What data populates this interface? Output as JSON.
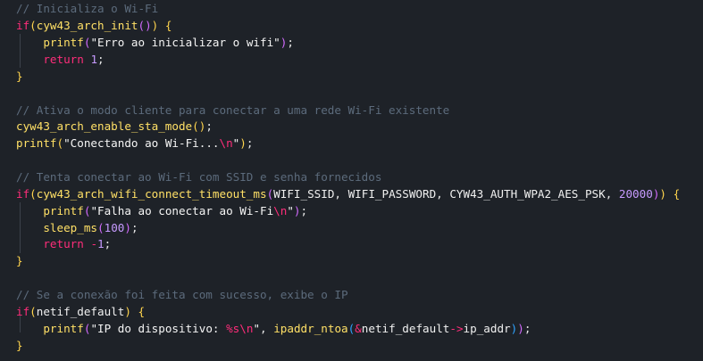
{
  "lines": [
    {
      "tokens": [
        {
          "t": "// Inicializa o Wi-Fi",
          "c": "cmt"
        }
      ]
    },
    {
      "tokens": [
        {
          "t": "if",
          "c": "kw"
        },
        {
          "t": "(",
          "c": "br1"
        },
        {
          "t": "cyw43_arch_init",
          "c": "fn"
        },
        {
          "t": "()",
          "c": "br2"
        },
        {
          "t": ")",
          "c": "br1"
        },
        {
          "t": " ",
          "c": "pun"
        },
        {
          "t": "{",
          "c": "br1"
        }
      ]
    },
    {
      "tokens": [
        {
          "t": "    ",
          "c": "pun"
        },
        {
          "t": "printf",
          "c": "fn"
        },
        {
          "t": "(",
          "c": "br2"
        },
        {
          "t": "\"Erro ao inicializar o wifi\"",
          "c": "str"
        },
        {
          "t": ")",
          "c": "br2"
        },
        {
          "t": ";",
          "c": "pun"
        }
      ]
    },
    {
      "tokens": [
        {
          "t": "    ",
          "c": "pun"
        },
        {
          "t": "return",
          "c": "kw"
        },
        {
          "t": " ",
          "c": "pun"
        },
        {
          "t": "1",
          "c": "num"
        },
        {
          "t": ";",
          "c": "pun"
        }
      ]
    },
    {
      "tokens": [
        {
          "t": "}",
          "c": "br1"
        }
      ]
    },
    {
      "tokens": []
    },
    {
      "tokens": [
        {
          "t": "// Ativa o modo cliente para conectar a uma rede Wi-Fi existente",
          "c": "cmt"
        }
      ]
    },
    {
      "tokens": [
        {
          "t": "cyw43_arch_enable_sta_mode",
          "c": "fn"
        },
        {
          "t": "()",
          "c": "br1"
        },
        {
          "t": ";",
          "c": "pun"
        }
      ]
    },
    {
      "tokens": [
        {
          "t": "printf",
          "c": "fn"
        },
        {
          "t": "(",
          "c": "br1"
        },
        {
          "t": "\"Conectando ao Wi-Fi...",
          "c": "str"
        },
        {
          "t": "\\n",
          "c": "esc"
        },
        {
          "t": "\"",
          "c": "str"
        },
        {
          "t": ")",
          "c": "br1"
        },
        {
          "t": ";",
          "c": "pun"
        }
      ]
    },
    {
      "tokens": []
    },
    {
      "tokens": [
        {
          "t": "// Tenta conectar ao Wi-Fi com SSID e senha fornecidos",
          "c": "cmt"
        }
      ]
    },
    {
      "tokens": [
        {
          "t": "if",
          "c": "kw"
        },
        {
          "t": "(",
          "c": "br1"
        },
        {
          "t": "cyw43_arch_wifi_connect_timeout_ms",
          "c": "fn"
        },
        {
          "t": "(",
          "c": "br2"
        },
        {
          "t": "WIFI_SSID",
          "c": "id"
        },
        {
          "t": ", ",
          "c": "pun"
        },
        {
          "t": "WIFI_PASSWORD",
          "c": "id"
        },
        {
          "t": ", ",
          "c": "pun"
        },
        {
          "t": "CYW43_AUTH_WPA2_AES_PSK",
          "c": "id"
        },
        {
          "t": ", ",
          "c": "pun"
        },
        {
          "t": "20000",
          "c": "num"
        },
        {
          "t": ")",
          "c": "br2"
        },
        {
          "t": ")",
          "c": "br1"
        },
        {
          "t": " ",
          "c": "pun"
        },
        {
          "t": "{",
          "c": "br1"
        }
      ]
    },
    {
      "tokens": [
        {
          "t": "    ",
          "c": "pun"
        },
        {
          "t": "printf",
          "c": "fn"
        },
        {
          "t": "(",
          "c": "br2"
        },
        {
          "t": "\"Falha ao conectar ao Wi-Fi",
          "c": "str"
        },
        {
          "t": "\\n",
          "c": "esc"
        },
        {
          "t": "\"",
          "c": "str"
        },
        {
          "t": ")",
          "c": "br2"
        },
        {
          "t": ";",
          "c": "pun"
        }
      ]
    },
    {
      "tokens": [
        {
          "t": "    ",
          "c": "pun"
        },
        {
          "t": "sleep_ms",
          "c": "fn"
        },
        {
          "t": "(",
          "c": "br2"
        },
        {
          "t": "100",
          "c": "num"
        },
        {
          "t": ")",
          "c": "br2"
        },
        {
          "t": ";",
          "c": "pun"
        }
      ]
    },
    {
      "tokens": [
        {
          "t": "    ",
          "c": "pun"
        },
        {
          "t": "return",
          "c": "kw"
        },
        {
          "t": " ",
          "c": "pun"
        },
        {
          "t": "-",
          "c": "kw"
        },
        {
          "t": "1",
          "c": "num"
        },
        {
          "t": ";",
          "c": "pun"
        }
      ]
    },
    {
      "tokens": [
        {
          "t": "}",
          "c": "br1"
        }
      ]
    },
    {
      "tokens": []
    },
    {
      "tokens": [
        {
          "t": "// Se a conexão foi feita com sucesso, exibe o IP",
          "c": "cmt"
        }
      ]
    },
    {
      "tokens": [
        {
          "t": "if",
          "c": "kw"
        },
        {
          "t": "(",
          "c": "br1"
        },
        {
          "t": "netif_default",
          "c": "id"
        },
        {
          "t": ")",
          "c": "br1"
        },
        {
          "t": " ",
          "c": "pun"
        },
        {
          "t": "{",
          "c": "br1"
        }
      ]
    },
    {
      "tokens": [
        {
          "t": "    ",
          "c": "pun"
        },
        {
          "t": "printf",
          "c": "fn"
        },
        {
          "t": "(",
          "c": "br2"
        },
        {
          "t": "\"IP do dispositivo: ",
          "c": "str"
        },
        {
          "t": "%s",
          "c": "esc"
        },
        {
          "t": "\\n",
          "c": "esc"
        },
        {
          "t": "\"",
          "c": "str"
        },
        {
          "t": ", ",
          "c": "pun"
        },
        {
          "t": "ipaddr_ntoa",
          "c": "fn"
        },
        {
          "t": "(",
          "c": "br3"
        },
        {
          "t": "&",
          "c": "kw"
        },
        {
          "t": "netif_default",
          "c": "id"
        },
        {
          "t": "->",
          "c": "kw"
        },
        {
          "t": "ip_addr",
          "c": "id"
        },
        {
          "t": ")",
          "c": "br3"
        },
        {
          "t": ")",
          "c": "br2"
        },
        {
          "t": ";",
          "c": "pun"
        }
      ]
    },
    {
      "tokens": [
        {
          "t": "}",
          "c": "br1"
        }
      ]
    }
  ],
  "theme": {
    "background": "#1e2228",
    "keyword": "#ff2d7a",
    "function": "#ffe066",
    "number": "#c79bff",
    "comment": "#5c6b7c"
  }
}
